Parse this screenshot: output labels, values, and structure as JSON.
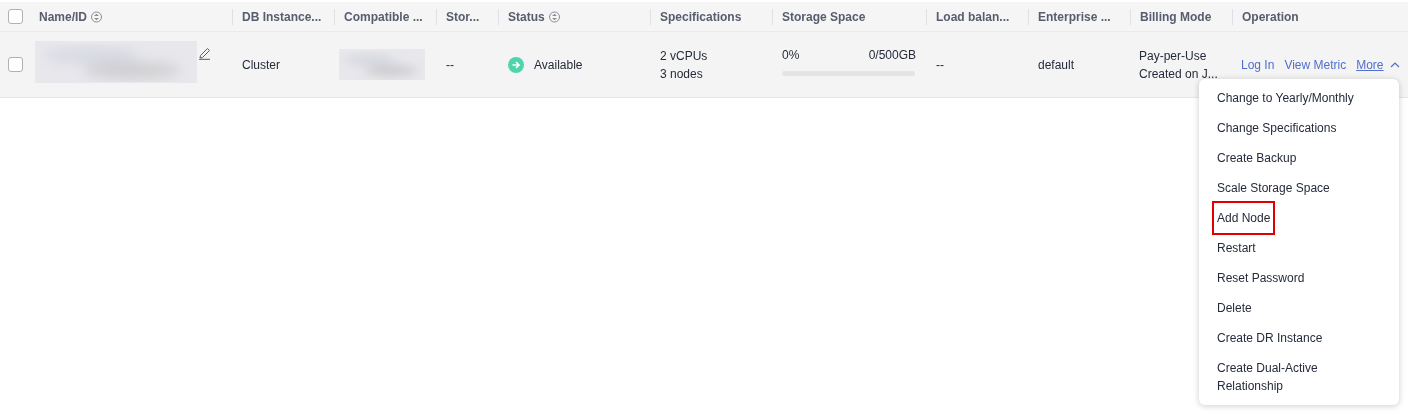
{
  "table": {
    "header_checkbox": {
      "checked": false
    },
    "columns": [
      {
        "label": "Name/ID",
        "sortable": true
      },
      {
        "label": "DB Instance...",
        "sortable": false
      },
      {
        "label": "Compatible ...",
        "sortable": false
      },
      {
        "label": "Stor...",
        "sortable": false
      },
      {
        "label": "Status",
        "sortable": true
      },
      {
        "label": "Specifications",
        "sortable": false
      },
      {
        "label": "Storage Space",
        "sortable": false
      },
      {
        "label": "Load balan...",
        "sortable": false
      },
      {
        "label": "Enterprise ...",
        "sortable": false
      },
      {
        "label": "Billing Mode",
        "sortable": false
      },
      {
        "label": "Operation",
        "sortable": false
      }
    ],
    "rows": [
      {
        "checked": false,
        "db_instance_type": "Cluster",
        "storage_type": "--",
        "status": "Available",
        "specifications": [
          "2 vCPUs",
          "3 nodes"
        ],
        "storage": {
          "percent": "0%",
          "usage": "0/500GB",
          "level": 0
        },
        "load_balancer": "--",
        "enterprise_project": "default",
        "billing": [
          "Pay-per-Use",
          "Created on J..."
        ],
        "operations": [
          "Log In",
          "View Metric"
        ],
        "more": {
          "label": "More",
          "expanded": true
        }
      }
    ]
  },
  "more_menu": {
    "items": [
      {
        "label": "Change to Yearly/Monthly",
        "highlighted": false
      },
      {
        "label": "Change Specifications",
        "highlighted": false
      },
      {
        "label": "Create Backup",
        "highlighted": false
      },
      {
        "label": "Scale Storage Space",
        "highlighted": false
      },
      {
        "label": "Add Node",
        "highlighted": true
      },
      {
        "label": "Restart",
        "highlighted": false
      },
      {
        "label": "Reset Password",
        "highlighted": false
      },
      {
        "label": "Delete",
        "highlighted": false
      },
      {
        "label": "Create DR Instance",
        "highlighted": false
      },
      {
        "label": "Create Dual-Active Relationship",
        "highlighted": false
      }
    ]
  }
}
